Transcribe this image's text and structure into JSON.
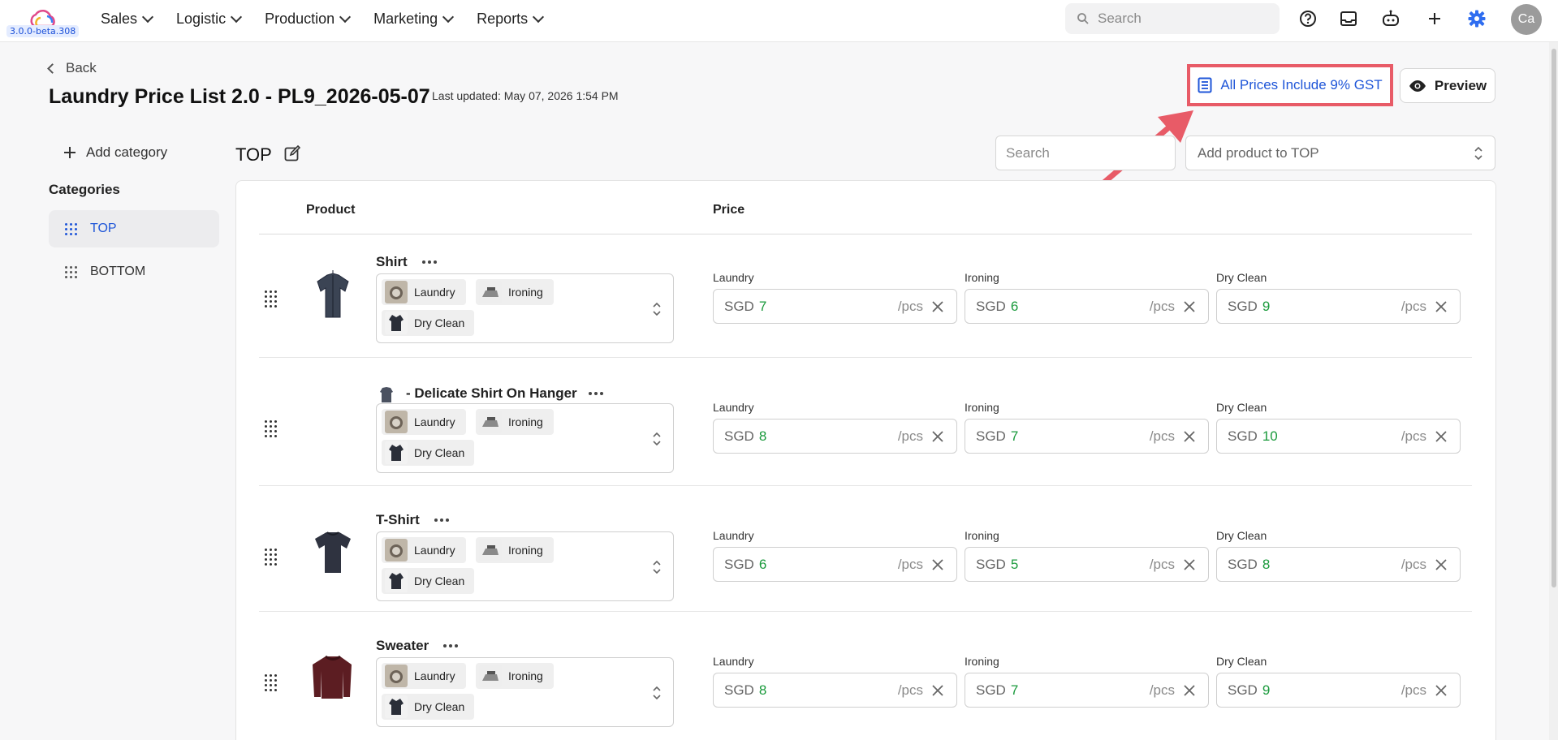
{
  "app": {
    "version": "3.0.0-beta.308",
    "avatar_initials": "Ca"
  },
  "nav": [
    "Sales",
    "Logistic",
    "Production",
    "Marketing",
    "Reports"
  ],
  "top_search_placeholder": "Search",
  "back_label": "Back",
  "page_title": "Laundry Price List 2.0 - PL9_2026-05-07",
  "last_updated": "Last updated: May 07, 2026 1:54 PM",
  "gst_label": "All Prices Include 9% GST",
  "preview_label": "Preview",
  "add_category_label": "Add category",
  "categories_heading": "Categories",
  "categories": [
    "TOP",
    "BOTTOM"
  ],
  "section_title": "TOP",
  "table_search_placeholder": "Search",
  "add_product_placeholder": "Add product to TOP",
  "columns": {
    "product": "Product",
    "price": "Price"
  },
  "services": [
    "Laundry",
    "Ironing",
    "Dry Clean"
  ],
  "currency": "SGD",
  "unit": "/pcs",
  "products": [
    {
      "name": "Shirt",
      "prices": [
        "7",
        "6",
        "9"
      ]
    },
    {
      "name": "- Delicate Shirt On Hanger",
      "prices": [
        "8",
        "7",
        "10"
      ]
    },
    {
      "name": "T-Shirt",
      "prices": [
        "6",
        "5",
        "8"
      ]
    },
    {
      "name": "Sweater",
      "prices": [
        "8",
        "7",
        "9"
      ]
    }
  ],
  "colors": {
    "accent": "#1f56d8",
    "highlight_border": "#e85b67",
    "price_value": "#1a9a3c"
  }
}
